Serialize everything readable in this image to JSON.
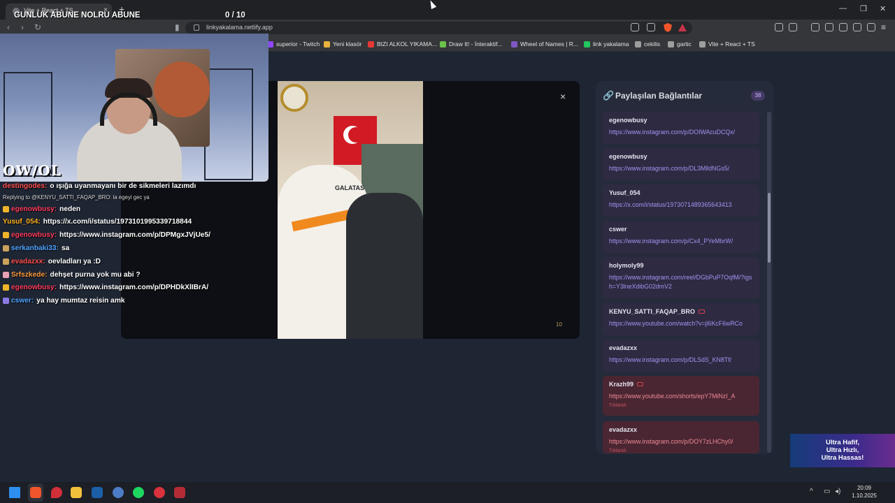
{
  "browser": {
    "tab_title": "Vite + React + TS",
    "url": "linkyakalama.netlify.app",
    "bookmarks": [
      {
        "label": "superior - Twitch",
        "color": "#9146ff"
      },
      {
        "label": "Yeni klasör",
        "color": "#e8b33a"
      },
      {
        "label": "BIZI ALKOL YIKAMA...",
        "color": "#e53935"
      },
      {
        "label": "Draw It! - İnteraktif...",
        "color": "#6cc24a"
      },
      {
        "label": "Wheel of Names | R...",
        "color": "#7e57c2"
      },
      {
        "label": "link yakalama",
        "color": "#22c55e"
      },
      {
        "label": "cekilis",
        "color": "#9e9e9e"
      },
      {
        "label": "gartic",
        "color": "#9e9e9e"
      },
      {
        "label": "Vite + React + TS",
        "color": "#9e9e9e"
      }
    ]
  },
  "overlay": {
    "goal_label": "GUNLUK ABUNE NOLRU ABUNE",
    "goal_count": "0  / 10",
    "webcam_logo": "OW/OL",
    "chat": [
      {
        "user": "destingodes:",
        "text": "o ışığa uyanmayanı bir de sikmeleri lazımdı",
        "user_color": "#ff4d4d",
        "badge": ""
      },
      {
        "reply": "Replying to @KENYU_SATTI_FAQAP_BRO: la egeyi gec ya"
      },
      {
        "user": "egenowbusy:",
        "text": "neden",
        "user_color": "#ff3b5c",
        "badge": "#f0b429"
      },
      {
        "user": "Yusuf_054:",
        "text": "https://x.com/i/status/1973101995339718844",
        "user_color": "#ffb020",
        "badge": ""
      },
      {
        "user": "egenowbusy:",
        "text": "https://www.instagram.com/p/DPMgxJVjUe5/",
        "user_color": "#ff3b5c",
        "badge": "#f0b429"
      },
      {
        "user": "serkanbaki33:",
        "text": "sa",
        "user_color": "#4da3ff",
        "badge": "#c9a25b"
      },
      {
        "user": "evadazxx:",
        "text": "oevladları ya :D",
        "user_color": "#ff4d4d",
        "badge": "#c9a25b"
      },
      {
        "user": "Srfszkede:",
        "text": "dehşet purna yok mu abi ?",
        "user_color": "#ff9a3c",
        "badge": "#e8a0b4"
      },
      {
        "user": "egenowbusy:",
        "text": "https://www.instagram.com/p/DPHDkXlIBrA/",
        "user_color": "#ff3b5c",
        "badge": "#f0b429"
      },
      {
        "user": "cswer:",
        "text": "ya hay mumtaz reisin amk",
        "user_color": "#4da3ff",
        "badge": "#8b7ae6"
      }
    ],
    "ad_text": "Ultra Hafif,\nUltra Hızlı,\nUltra Hassas!"
  },
  "modal": {
    "close_label": "×",
    "video_caption": "GALATAS",
    "watermark": "10"
  },
  "panel": {
    "title": "Paylaşılan Bağlantılar",
    "count": "38",
    "items": [
      {
        "user": "egenowbusy",
        "link": "https://www.instagram.com/p/DOIWAcuDCQx/",
        "youtube": false,
        "watched": false
      },
      {
        "user": "egenowbusy",
        "link": "https://www.instagram.com/p/DL3MlldNGs5/",
        "youtube": false,
        "watched": false
      },
      {
        "user": "Yusuf_054",
        "link": "https://x.com/i/status/1973071489365643413",
        "youtube": false,
        "watched": false
      },
      {
        "user": "cswer",
        "link": "https://www.instagram.com/p/Cx4_PYeMbrW/",
        "youtube": false,
        "watched": false
      },
      {
        "user": "holymoly99",
        "link": "https://www.instagram.com/reel/DGbPuP7OqfM/?igsh=Y3lneXdibG02dmV2",
        "youtube": false,
        "watched": false
      },
      {
        "user": "KENYU_SATTI_FAQAP_BRO",
        "link": "https://www.youtube.com/watch?v=jl6KcF6wRCo",
        "youtube": true,
        "watched": false
      },
      {
        "user": "evadazxx",
        "link": "https://www.instagram.com/p/DLSdS_KN8Tf/",
        "youtube": false,
        "watched": false
      },
      {
        "user": "Krazh99",
        "link": "https://www.youtube.com/shorts/epY7MiNzI_A",
        "youtube": true,
        "watched": true,
        "seen_label": "Tıklandı"
      },
      {
        "user": "evadazxx",
        "link": "https://www.instagram.com/p/DOY7zLHChy0/",
        "youtube": false,
        "watched": true,
        "seen_label": "Tıklandı"
      }
    ]
  },
  "taskbar": {
    "time": "20:09",
    "date": "1.10.2025",
    "tray_chevron": "^"
  }
}
